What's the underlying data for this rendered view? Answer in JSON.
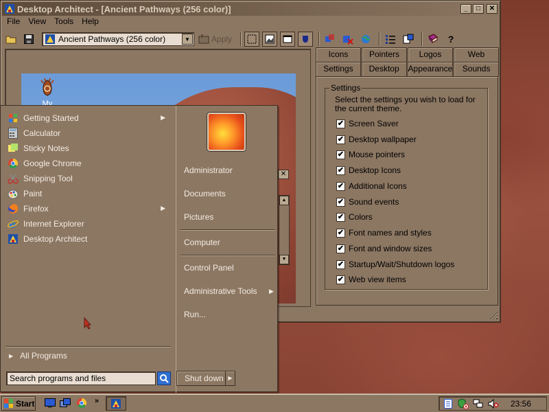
{
  "window": {
    "title": "Desktop Architect - [Ancient Pathways (256 color)]",
    "minimize": "_",
    "maximize": "□",
    "close": "✕"
  },
  "menu": [
    "File",
    "View",
    "Tools",
    "Help"
  ],
  "toolbar": {
    "theme_value": "Ancient Pathways (256 color)",
    "apply_label": "Apply",
    "icons": [
      "open-folder-icon",
      "save-icon",
      "theme-icon",
      "dropdown-icon",
      "apply-icon",
      "screensaver-icon",
      "wallpaper-icon",
      "window-icon",
      "colors-icon",
      "refresh-icon",
      "delete-icon",
      "globe-icon",
      "list-icon",
      "properties-icon",
      "book-icon",
      "help-icon"
    ]
  },
  "preview": {
    "my_computer_label": "My Computer",
    "close": "✕"
  },
  "tabs": {
    "row1": [
      "Icons",
      "Pointers",
      "Logos",
      "Web"
    ],
    "row2": [
      "Settings",
      "Desktop",
      "Appearance",
      "Sounds"
    ],
    "active": "Settings"
  },
  "settings": {
    "group_label": "Settings",
    "description": "Select the settings you wish to load for the current theme.",
    "items": [
      {
        "label": "Screen Saver",
        "checked": true
      },
      {
        "label": "Desktop wallpaper",
        "checked": true
      },
      {
        "label": "Mouse pointers",
        "checked": true
      },
      {
        "label": "Desktop Icons",
        "checked": true
      },
      {
        "label": "Additional Icons",
        "checked": true
      },
      {
        "label": "Sound events",
        "checked": true
      },
      {
        "label": "Colors",
        "checked": true
      },
      {
        "label": "Font names and styles",
        "checked": true
      },
      {
        "label": "Font and window sizes",
        "checked": true
      },
      {
        "label": "Startup/Wait/Shutdown logos",
        "checked": true
      },
      {
        "label": "Web view items",
        "checked": true
      }
    ]
  },
  "start_menu": {
    "programs": [
      {
        "label": "Getting Started",
        "icon": "getting-started-icon",
        "submenu": true
      },
      {
        "label": "Calculator",
        "icon": "calculator-icon",
        "submenu": false
      },
      {
        "label": "Sticky Notes",
        "icon": "sticky-notes-icon",
        "submenu": false
      },
      {
        "label": "Google Chrome",
        "icon": "chrome-icon",
        "submenu": false
      },
      {
        "label": "Snipping Tool",
        "icon": "snipping-tool-icon",
        "submenu": false
      },
      {
        "label": "Paint",
        "icon": "paint-icon",
        "submenu": false
      },
      {
        "label": "Firefox",
        "icon": "firefox-icon",
        "submenu": true
      },
      {
        "label": "Internet Explorer",
        "icon": "internet-explorer-icon",
        "submenu": false
      },
      {
        "label": "Desktop Architect",
        "icon": "desktop-architect-icon",
        "submenu": false
      }
    ],
    "all_programs": "All Programs",
    "search_placeholder": "Search programs and files",
    "right_items": [
      "Administrator",
      "Documents",
      "Pictures",
      "Computer",
      "Control Panel",
      "Administrative Tools",
      "Run..."
    ],
    "shutdown": "Shut down"
  },
  "taskbar": {
    "start_label": "Start",
    "quick_launch_more": "»",
    "clock": "23:56"
  }
}
